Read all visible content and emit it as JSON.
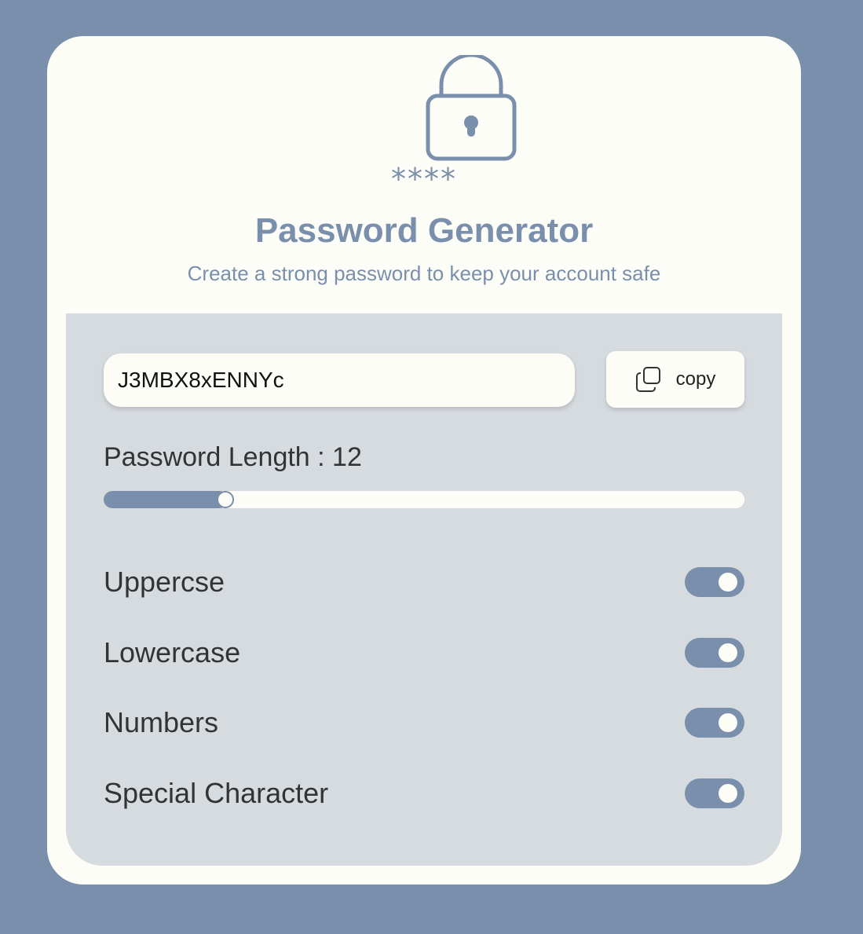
{
  "header": {
    "lock_icon": "padlock-icon",
    "stars": "****",
    "title": "Password Generator",
    "subtitle": "Create a strong password to keep your account safe"
  },
  "password": {
    "value": "J3MBX8xENNYc"
  },
  "copy_button": {
    "icon": "copy-icon",
    "label": "copy"
  },
  "length": {
    "label": "Password Length : 12",
    "value": 12,
    "slider_fraction": 0.187
  },
  "options": [
    {
      "label": "Uppercse",
      "enabled": true
    },
    {
      "label": "Lowercase",
      "enabled": true
    },
    {
      "label": "Numbers",
      "enabled": true
    },
    {
      "label": "Special Character",
      "enabled": true
    }
  ],
  "colors": {
    "accent": "#7a8fab",
    "card": "#fdfdf8",
    "panel": "#d6dbe0"
  }
}
